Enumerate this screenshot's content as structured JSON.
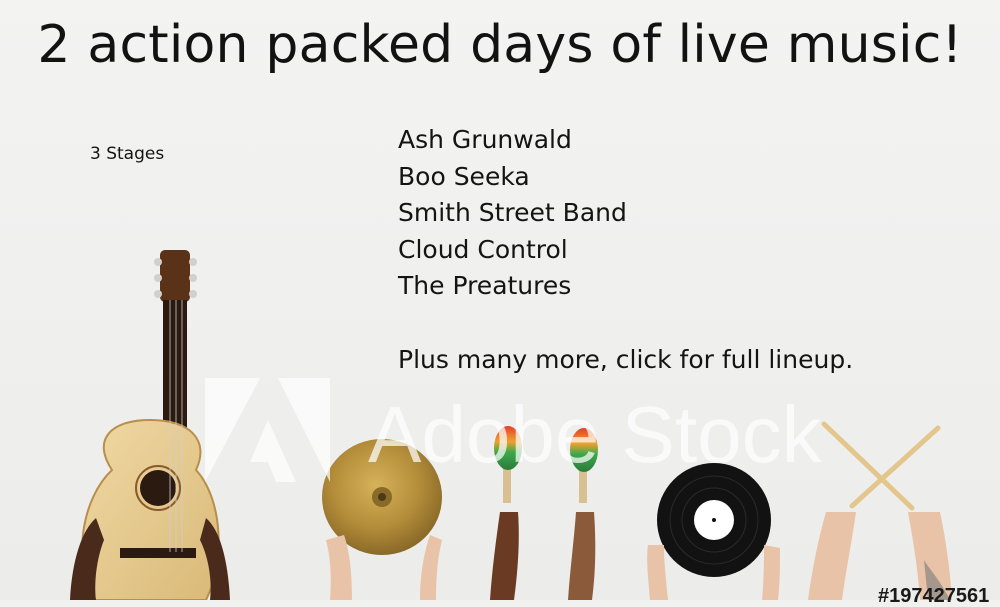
{
  "headline": "2 action packed days of live music!",
  "stages_note": "3 Stages",
  "lineup": [
    "Ash Grunwald",
    "Boo Seeka",
    "Smith Street Band",
    "Cloud Control",
    "The Preatures"
  ],
  "more_link": "Plus many more, click for full lineup.",
  "watermark": {
    "text": "Adobe Stock"
  },
  "image_id": "#197427561",
  "illustration_items": [
    "guitar",
    "cymbal",
    "maracas",
    "vinyl-record",
    "drumsticks"
  ]
}
